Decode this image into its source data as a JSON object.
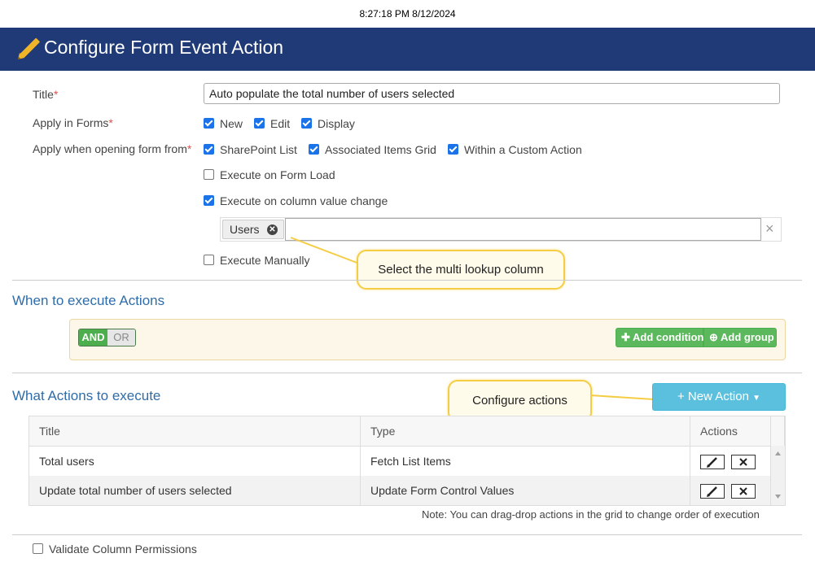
{
  "timestamp": "8:27:18 PM 8/12/2024",
  "header": {
    "title": "Configure Form Event Action",
    "icon": "pencil-icon"
  },
  "form": {
    "title_label": "Title",
    "title_value": "Auto populate the total number of users selected",
    "apply_in_forms_label": "Apply in Forms",
    "forms": [
      {
        "label": "New",
        "checked": true
      },
      {
        "label": "Edit",
        "checked": true
      },
      {
        "label": "Display",
        "checked": true
      }
    ],
    "apply_when_label": "Apply when opening form from",
    "sources": [
      {
        "label": "SharePoint List",
        "checked": true
      },
      {
        "label": "Associated Items Grid",
        "checked": true
      },
      {
        "label": "Within a Custom Action",
        "checked": true
      }
    ],
    "execute_on_load": {
      "label": "Execute on Form Load",
      "checked": false
    },
    "execute_on_change": {
      "label": "Execute on column value change",
      "checked": true
    },
    "selected_columns": [
      "Users"
    ],
    "clear_symbol": "×",
    "execute_manually": {
      "label": "Execute Manually",
      "checked": false
    },
    "required_marker": "*"
  },
  "callouts": {
    "lookup": "Select the multi lookup column",
    "actions": "Configure actions"
  },
  "when_section": {
    "title": "When to execute Actions",
    "and_label": "AND",
    "or_label": "OR",
    "add_condition": "Add condition",
    "add_group": "Add group"
  },
  "what_section": {
    "title": "What Actions to execute",
    "new_action": "New Action",
    "columns": [
      "Title",
      "Type",
      "Actions"
    ],
    "rows": [
      {
        "title": "Total users",
        "type": "Fetch List Items"
      },
      {
        "title": "Update total number of users selected",
        "type": "Update Form Control Values"
      }
    ],
    "note": "Note: You can drag-drop actions in the grid to change order of execution"
  },
  "validate": {
    "label": "Validate Column Permissions",
    "checked": false
  },
  "colors": {
    "header": "#1f3a77",
    "accent": "#2f6ca8",
    "green": "#5cb85c",
    "info": "#5bc0de",
    "callout_border": "#f5cd45"
  }
}
